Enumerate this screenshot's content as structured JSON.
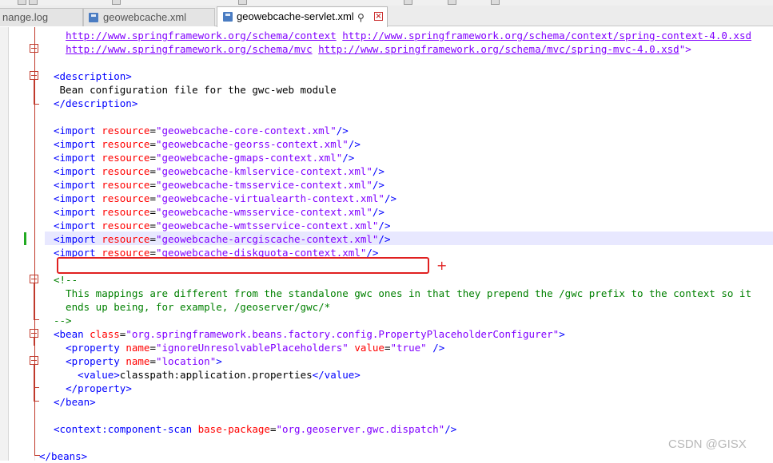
{
  "tabs": [
    {
      "label": "nange.log",
      "active": false
    },
    {
      "label": "geowebcache.xml",
      "active": false
    },
    {
      "label": "geowebcache-servlet.xml",
      "active": true
    }
  ],
  "editor": {
    "lines": [
      [
        {
          "t": "x",
          "s": "  "
        },
        {
          "t": "u",
          "s": "http://www.springframework.org/schema/context"
        },
        {
          "t": "x",
          "s": " "
        },
        {
          "t": "u",
          "s": "http://www.springframework.org/schema/context/spring-context-4.0.xsd"
        }
      ],
      [
        {
          "t": "x",
          "s": "  "
        },
        {
          "t": "u",
          "s": "http://www.springframework.org/schema/mvc"
        },
        {
          "t": "x",
          "s": " "
        },
        {
          "t": "u",
          "s": "http://www.springframework.org/schema/mvc/spring-mvc-4.0.xsd"
        },
        {
          "t": "v",
          "s": "\">"
        }
      ],
      [],
      [
        {
          "t": "t",
          "s": "<description>"
        }
      ],
      [
        {
          "t": "x",
          "s": " Bean configuration file for the gwc-web module"
        }
      ],
      [
        {
          "t": "t",
          "s": "</description>"
        }
      ],
      [],
      [
        {
          "t": "t",
          "s": "<import "
        },
        {
          "t": "a",
          "s": "resource"
        },
        {
          "t": "x",
          "s": "="
        },
        {
          "t": "v",
          "s": "\"geowebcache-core-context.xml\""
        },
        {
          "t": "t",
          "s": "/>"
        }
      ],
      [
        {
          "t": "t",
          "s": "<import "
        },
        {
          "t": "a",
          "s": "resource"
        },
        {
          "t": "x",
          "s": "="
        },
        {
          "t": "v",
          "s": "\"geowebcache-georss-context.xml\""
        },
        {
          "t": "t",
          "s": "/>"
        }
      ],
      [
        {
          "t": "t",
          "s": "<import "
        },
        {
          "t": "a",
          "s": "resource"
        },
        {
          "t": "x",
          "s": "="
        },
        {
          "t": "v",
          "s": "\"geowebcache-gmaps-context.xml\""
        },
        {
          "t": "t",
          "s": "/>"
        }
      ],
      [
        {
          "t": "t",
          "s": "<import "
        },
        {
          "t": "a",
          "s": "resource"
        },
        {
          "t": "x",
          "s": "="
        },
        {
          "t": "v",
          "s": "\"geowebcache-kmlservice-context.xml\""
        },
        {
          "t": "t",
          "s": "/>"
        }
      ],
      [
        {
          "t": "t",
          "s": "<import "
        },
        {
          "t": "a",
          "s": "resource"
        },
        {
          "t": "x",
          "s": "="
        },
        {
          "t": "v",
          "s": "\"geowebcache-tmsservice-context.xml\""
        },
        {
          "t": "t",
          "s": "/>"
        }
      ],
      [
        {
          "t": "t",
          "s": "<import "
        },
        {
          "t": "a",
          "s": "resource"
        },
        {
          "t": "x",
          "s": "="
        },
        {
          "t": "v",
          "s": "\"geowebcache-virtualearth-context.xml\""
        },
        {
          "t": "t",
          "s": "/>"
        }
      ],
      [
        {
          "t": "t",
          "s": "<import "
        },
        {
          "t": "a",
          "s": "resource"
        },
        {
          "t": "x",
          "s": "="
        },
        {
          "t": "v",
          "s": "\"geowebcache-wmsservice-context.xml\""
        },
        {
          "t": "t",
          "s": "/>"
        }
      ],
      [
        {
          "t": "t",
          "s": "<import "
        },
        {
          "t": "a",
          "s": "resource"
        },
        {
          "t": "x",
          "s": "="
        },
        {
          "t": "v",
          "s": "\"geowebcache-wmtsservice-context.xml\""
        },
        {
          "t": "t",
          "s": "/>"
        }
      ],
      [
        {
          "t": "t",
          "s": "<import "
        },
        {
          "t": "a",
          "s": "resource"
        },
        {
          "t": "x",
          "s": "="
        },
        {
          "t": "v",
          "s": "\"geowebcache-arcgiscache-context.xml\""
        },
        {
          "t": "t",
          "s": "/>"
        }
      ],
      [
        {
          "t": "t",
          "s": "<import "
        },
        {
          "t": "a",
          "s": "resource"
        },
        {
          "t": "x",
          "s": "="
        },
        {
          "t": "v",
          "s": "\"geowebcache-diskquota-context.xml\""
        },
        {
          "t": "t",
          "s": "/>"
        }
      ],
      [],
      [
        {
          "t": "c",
          "s": "<!--"
        }
      ],
      [
        {
          "t": "c",
          "s": "  This mappings are different from the standalone gwc ones in that they prepend the /gwc prefix to the context so it"
        }
      ],
      [
        {
          "t": "c",
          "s": "  ends up being, for example, /geoserver/gwc/*"
        }
      ],
      [
        {
          "t": "c",
          "s": "-->"
        }
      ],
      [
        {
          "t": "t",
          "s": "<bean "
        },
        {
          "t": "a",
          "s": "class"
        },
        {
          "t": "x",
          "s": "="
        },
        {
          "t": "v",
          "s": "\"org.springframework.beans.factory.config.PropertyPlaceholderConfigurer\""
        },
        {
          "t": "t",
          "s": ">"
        }
      ],
      [
        {
          "t": "x",
          "s": "  "
        },
        {
          "t": "t",
          "s": "<property "
        },
        {
          "t": "a",
          "s": "name"
        },
        {
          "t": "x",
          "s": "="
        },
        {
          "t": "v",
          "s": "\"ignoreUnresolvablePlaceholders\""
        },
        {
          "t": "x",
          "s": " "
        },
        {
          "t": "a",
          "s": "value"
        },
        {
          "t": "x",
          "s": "="
        },
        {
          "t": "v",
          "s": "\"true\""
        },
        {
          "t": "x",
          "s": " "
        },
        {
          "t": "t",
          "s": "/>"
        }
      ],
      [
        {
          "t": "x",
          "s": "  "
        },
        {
          "t": "t",
          "s": "<property "
        },
        {
          "t": "a",
          "s": "name"
        },
        {
          "t": "x",
          "s": "="
        },
        {
          "t": "v",
          "s": "\"location\""
        },
        {
          "t": "t",
          "s": ">"
        }
      ],
      [
        {
          "t": "x",
          "s": "    "
        },
        {
          "t": "t",
          "s": "<value>"
        },
        {
          "t": "x",
          "s": "classpath:application.properties"
        },
        {
          "t": "t",
          "s": "</value>"
        }
      ],
      [
        {
          "t": "x",
          "s": "  "
        },
        {
          "t": "t",
          "s": "</property>"
        }
      ],
      [
        {
          "t": "t",
          "s": "</bean>"
        }
      ],
      [],
      [
        {
          "t": "t",
          "s": "<context:component-scan "
        },
        {
          "t": "a",
          "s": "base-package"
        },
        {
          "t": "x",
          "s": "="
        },
        {
          "t": "v",
          "s": "\"org.geoserver.gwc.dispatch\""
        },
        {
          "t": "t",
          "s": "/>"
        }
      ],
      [],
      [
        {
          "t": "t",
          "s": "</beans>"
        }
      ]
    ]
  },
  "annotation": {
    "plus": "+"
  },
  "watermark": "CSDN @GISX"
}
